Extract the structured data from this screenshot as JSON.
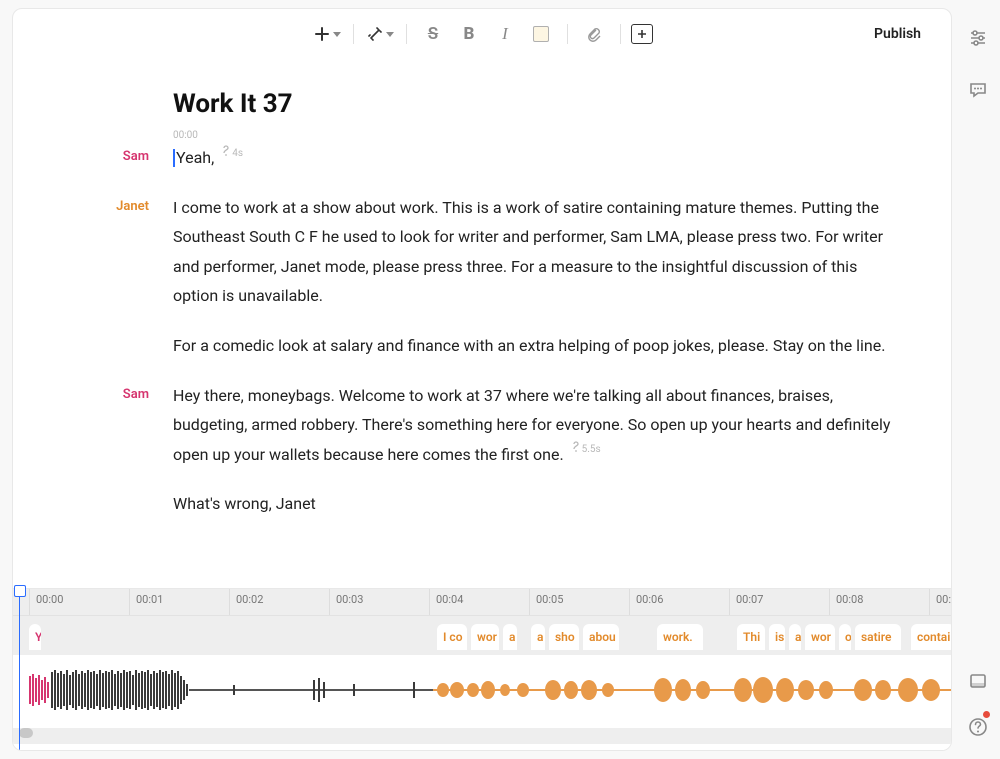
{
  "toolbar": {
    "publish_label": "Publish",
    "strike_glyph": "S",
    "bold_glyph": "B",
    "italic_glyph": "I"
  },
  "document": {
    "title": "Work It 37"
  },
  "transcript": {
    "row1": {
      "speaker": "Sam",
      "timestamp": "00:00",
      "text": "Yeah,",
      "pause": "4s"
    },
    "row2": {
      "speaker": "Janet",
      "p1": "I come to work at a show about work. This is a work of satire containing mature themes. Putting the Southeast South C F he used to look for writer and performer, Sam LMA, please press two. For writer and performer, Janet mode, please press three. For a measure to the insightful discussion of this option is unavailable.",
      "p2": "For a comedic look at salary and finance with an extra helping of poop jokes, please. Stay on the line."
    },
    "row3": {
      "speaker": "Sam",
      "p1_a": "Hey there, moneybags. Welcome to work at 37 where we're talking all about finances, braises, budgeting, armed robbery. There's something here for everyone. So open up your hearts and definitely open up your wallets because here comes the first one.",
      "pause": "5.5s",
      "p2": "What's wrong, Janet"
    }
  },
  "timeline": {
    "ticks": [
      "00:00",
      "00:01",
      "00:02",
      "00:03",
      "00:04",
      "00:05",
      "00:06",
      "00:07",
      "00:08",
      "00:"
    ],
    "words": {
      "w0": "Y",
      "w1": "I co",
      "w2": "wor",
      "w3": "a",
      "w4": "a",
      "w5": "sho",
      "w6": "abou",
      "w7": "work.",
      "w8": "Thi",
      "w9": "is",
      "w10": "a",
      "w11": "wor",
      "w12": "o",
      "w13": "satire",
      "w14": "contain"
    }
  }
}
